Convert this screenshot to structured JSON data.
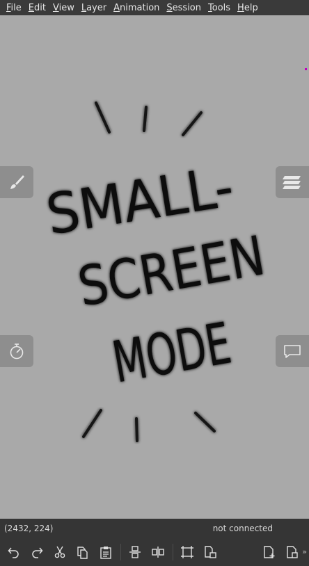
{
  "menubar": {
    "items": [
      {
        "u": "F",
        "rest": "ile"
      },
      {
        "u": "E",
        "rest": "dit"
      },
      {
        "u": "V",
        "rest": "iew"
      },
      {
        "u": "L",
        "rest": "ayer"
      },
      {
        "u": "A",
        "rest": "nimation"
      },
      {
        "u": "S",
        "rest": "ession"
      },
      {
        "u": "T",
        "rest": "ools"
      },
      {
        "u": "H",
        "rest": "elp"
      }
    ]
  },
  "canvas": {
    "text_lines": [
      "SMALL-",
      "SCREEN",
      "MODE"
    ],
    "ink_color": "#111111",
    "marker_color": "#c000c0"
  },
  "side_buttons": {
    "brush": "brush-icon",
    "layers": "layers-icon",
    "timer": "timer-icon",
    "chat": "chat-icon"
  },
  "status": {
    "coordinates": "(2432, 224)",
    "connection": "not connected"
  },
  "toolbar": {
    "icons": [
      "undo-icon",
      "redo-icon",
      "cut-icon",
      "copy-icon",
      "paste-icon",
      "stamp-icon",
      "flip-icon",
      "crop-icon",
      "resize-icon",
      "new-document-icon",
      "save-document-icon"
    ],
    "overflow": "»"
  }
}
